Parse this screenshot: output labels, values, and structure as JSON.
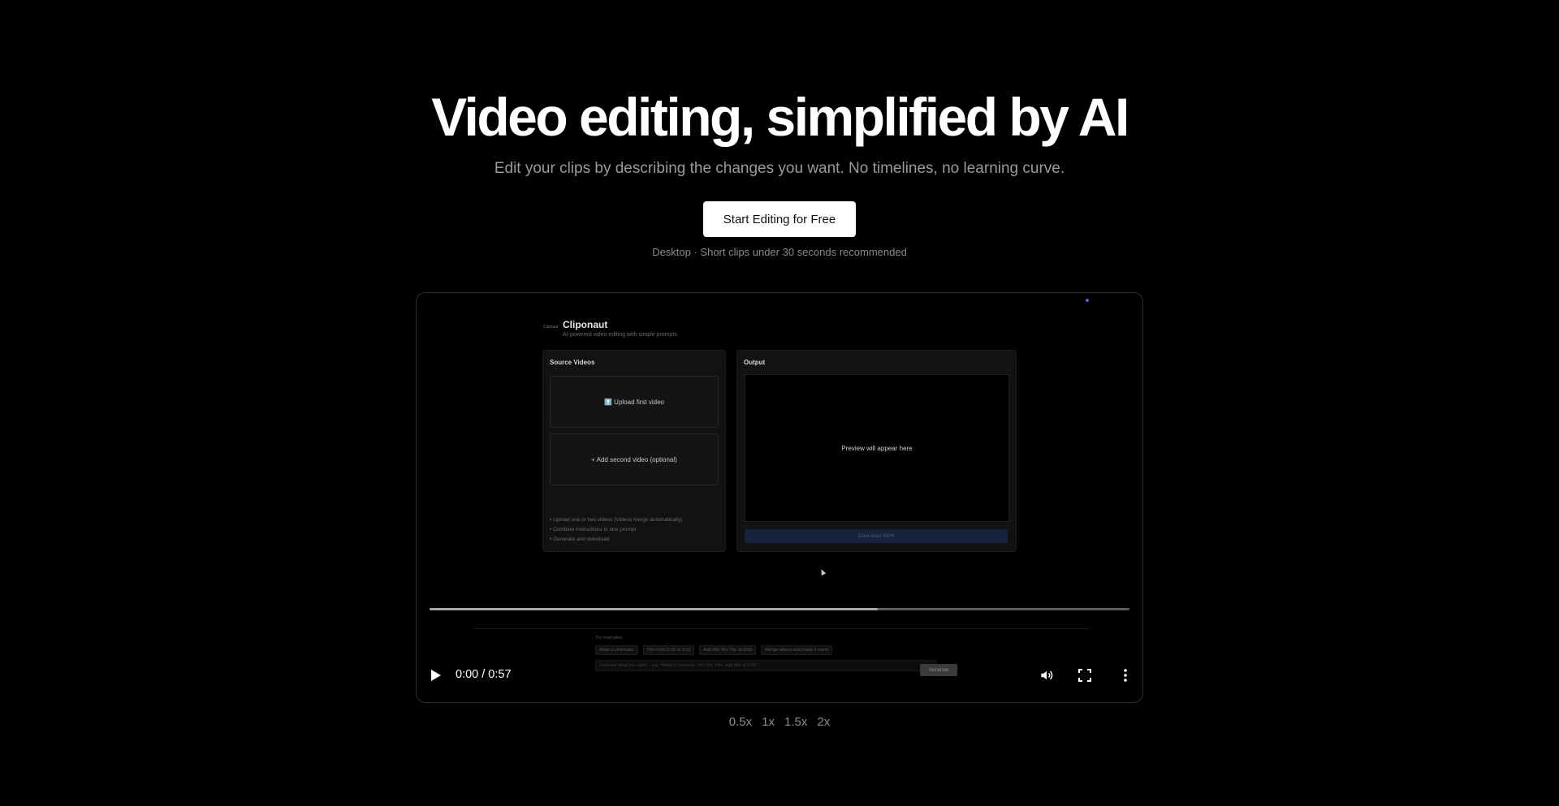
{
  "hero": {
    "title": "Video editing, simplified by AI",
    "subtitle": "Edit your clips by describing the changes you want. No timelines, no learning curve.",
    "cta_label": "Start Editing for Free",
    "hint": "Desktop · Short clips under 30 seconds recommended"
  },
  "video": {
    "time": "0:00 / 0:57",
    "buffered_fraction": 0.64,
    "app": {
      "logo_text": "Clipnaut",
      "title": "Cliponaut",
      "tagline": "AI-powered video editing with simple prompts",
      "source_heading": "Source Videos",
      "upload_first": "⬆️ Upload first video",
      "upload_second": "+ Add second video (optional)",
      "tips": [
        "• Upload one or two videos (Videos merge automatically)",
        "• Combine instructions in one prompt",
        "• Generate and download"
      ],
      "output_heading": "Output",
      "preview_text": "Preview will appear here",
      "download_label": "Download MP4",
      "examples_label": "Try examples:",
      "examples": [
        "Make it cinematic",
        "Trim from 0:00 to 0:10",
        "Add title 'My Trip' at 0:02",
        "Merge videos and make it warm"
      ],
      "prompt_placeholder": "Describe what you want... e.g. 'Make it cinematic, trim the intro, add title at 0:05'",
      "generate_label": "Generate"
    }
  },
  "speeds": [
    "0.5x",
    "1x",
    "1.5x",
    "2x"
  ],
  "colors": {
    "background": "#000000",
    "accent_dot": "#5a5cf0",
    "cta_background": "#ffffff"
  }
}
